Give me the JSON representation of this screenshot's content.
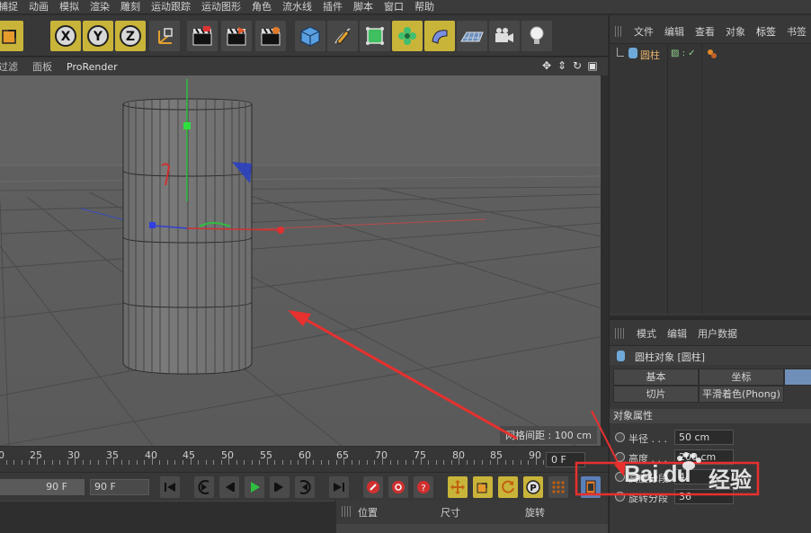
{
  "menu": [
    "捕捉",
    "动画",
    "模拟",
    "渲染",
    "雕刻",
    "运动跟踪",
    "运动图形",
    "角色",
    "流水线",
    "插件",
    "脚本",
    "窗口",
    "帮助"
  ],
  "viewport": {
    "menu": [
      "过滤",
      "面板",
      "ProRender"
    ],
    "grid_spacing": "网格间距 : 100 cm"
  },
  "toolbar": {
    "axis_x": "X",
    "axis_y": "Y",
    "axis_z": "Z"
  },
  "timeline": {
    "ticks": [
      "20",
      "25",
      "30",
      "35",
      "40",
      "45",
      "50",
      "55",
      "60",
      "65",
      "70",
      "75",
      "80",
      "85",
      "90"
    ],
    "current_frame": "0 F"
  },
  "transport": {
    "end_frame_slider": "90 F",
    "end_frame": "90 F"
  },
  "coordinates": {
    "headers": [
      "位置",
      "尺寸",
      "旋转"
    ]
  },
  "object_manager": {
    "tabs": [
      "文件",
      "编辑",
      "查看",
      "对象",
      "标签",
      "书签"
    ],
    "active_tab": "标签",
    "objects": [
      {
        "name": "圆柱"
      }
    ]
  },
  "attribute_manager": {
    "tabs": [
      "模式",
      "编辑",
      "用户数据"
    ],
    "title": "圆柱对象 [圆柱]",
    "buttons": [
      "基本",
      "坐标",
      "",
      "切片",
      "平滑着色(Phong)"
    ],
    "section": "对象属性",
    "props": [
      {
        "label": "半径 . . .",
        "value": "50 cm"
      },
      {
        "label": "高度 . . .",
        "value": "200 cm"
      },
      {
        "label": "高度分段",
        "value": "4"
      },
      {
        "label": "旋转分段",
        "value": "36"
      }
    ]
  },
  "watermark": {
    "brand": "Bai du",
    "suffix": "经验"
  },
  "colors": {
    "selection": "#3f6f9c",
    "highlight": "#c9b43a",
    "annotation": "#e8302e",
    "object_name": "#e8b26a"
  }
}
